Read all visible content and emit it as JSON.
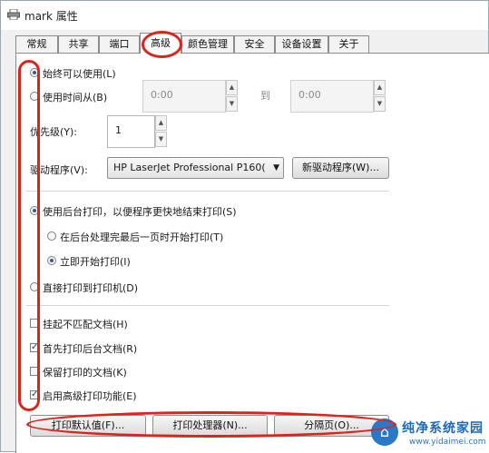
{
  "window": {
    "title": "mark 属性",
    "icon": "printer-icon"
  },
  "tabs": [
    {
      "label": "常规"
    },
    {
      "label": "共享"
    },
    {
      "label": "端口"
    },
    {
      "label": "高级",
      "active": true
    },
    {
      "label": "颜色管理"
    },
    {
      "label": "安全"
    },
    {
      "label": "设备设置"
    },
    {
      "label": "关于"
    }
  ],
  "availability": {
    "always_label": "始终可以使用(L)",
    "always_selected": true,
    "from_label": "使用时间从(B)",
    "from_selected": false,
    "start_time": "0:00",
    "to_label": "到",
    "end_time": "0:00"
  },
  "priority": {
    "label": "优先级(Y):",
    "value": "1"
  },
  "driver": {
    "label": "驱动程序(V):",
    "selected": "HP LaserJet Professional P160(",
    "new_button": "新驱动程序(W)..."
  },
  "spooling": {
    "spool_label": "使用后台打印，以便程序更快地结束打印(S)",
    "spool_selected": true,
    "after_last_page_label": "在后台处理完最后一页时开始打印(T)",
    "after_last_page_selected": false,
    "immediately_label": "立即开始打印(I)",
    "immediately_selected": true,
    "direct_label": "直接打印到打印机(D)",
    "direct_selected": false
  },
  "options": [
    {
      "label": "挂起不匹配文档(H)",
      "checked": false
    },
    {
      "label": "首先打印后台文档(R)",
      "checked": true
    },
    {
      "label": "保留打印的文档(K)",
      "checked": false
    },
    {
      "label": "启用高级打印功能(E)",
      "checked": true
    }
  ],
  "buttons": {
    "defaults": "打印默认值(F)...",
    "processor": "打印处理器(N)...",
    "separator": "分隔页(O)..."
  },
  "annotation_color": "#d9261c",
  "watermark": {
    "text": "纯净系统家园",
    "url": "www.yidaimei.com"
  }
}
